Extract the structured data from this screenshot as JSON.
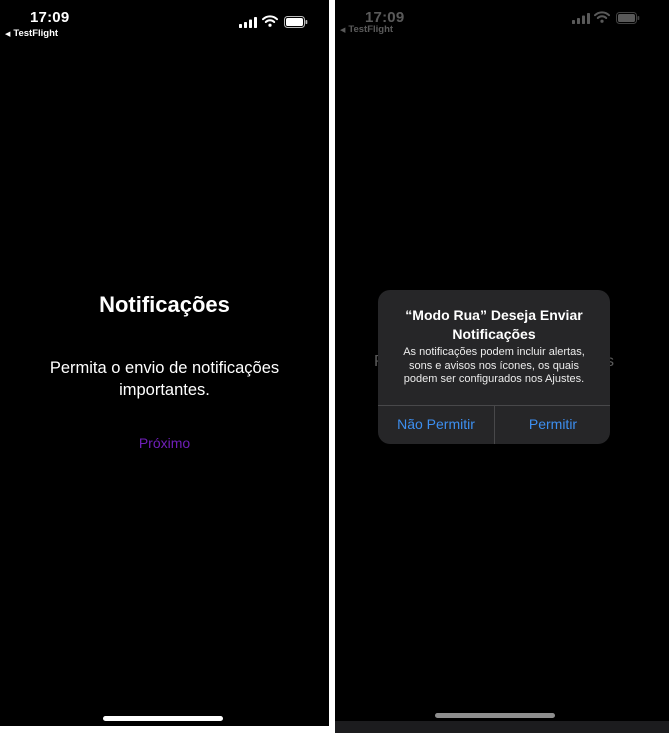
{
  "left_screen": {
    "status_bar": {
      "time": "17:09",
      "back_label": "TestFlight"
    },
    "title": "Notificações",
    "body_line1": "Permita o envio de notificações",
    "body_line2": "importantes.",
    "next_button": "Próximo"
  },
  "right_screen": {
    "status_bar": {
      "time": "17:09",
      "back_label": "TestFlight"
    },
    "background_fragment_left": "P",
    "background_fragment_right": "s",
    "alert": {
      "title_line1": "“Modo Rua” Deseja Enviar",
      "title_line2": "Notificações",
      "message_line1": "As notificações podem incluir alertas,",
      "message_line2": "sons e avisos nos ícones, os quais",
      "message_line3": "podem ser configurados nos Ajustes.",
      "deny_button": "Não Permitir",
      "allow_button": "Permitir"
    }
  },
  "colors": {
    "background": "#000000",
    "accent_purple": "#6f1fb8",
    "alert_background": "#262628",
    "alert_button": "#3d8ff0"
  },
  "icons": [
    "back-arrow-icon",
    "signal-icon",
    "wifi-icon",
    "battery-icon"
  ]
}
